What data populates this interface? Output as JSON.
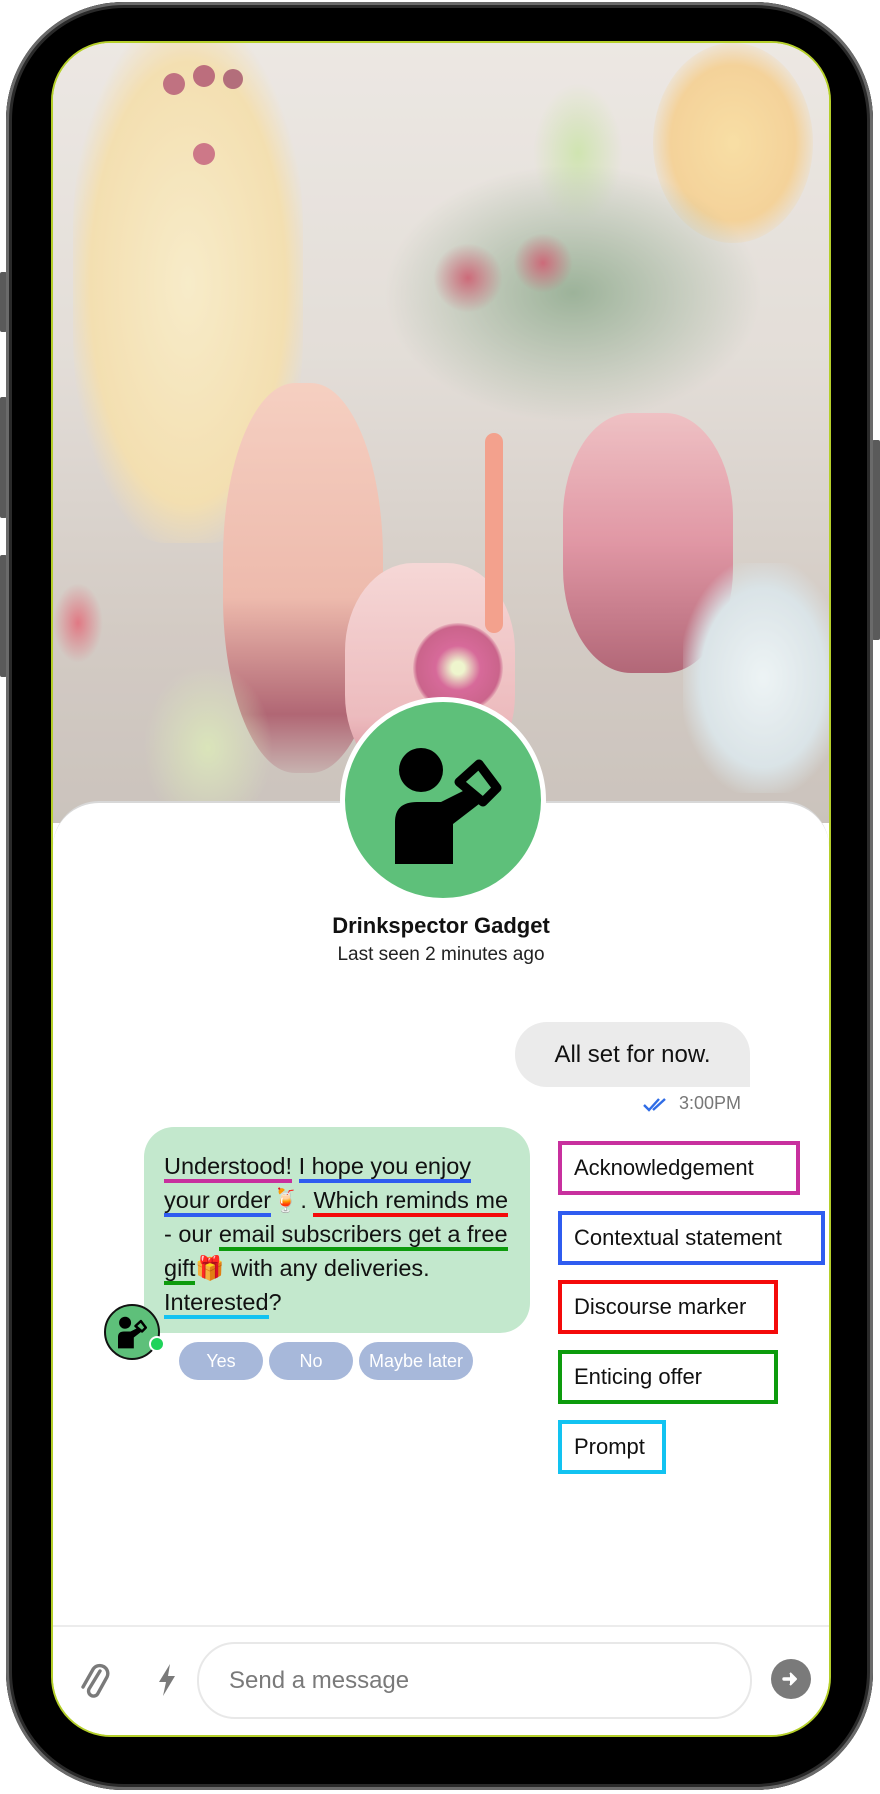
{
  "contact": {
    "name": "Drinkspector Gadget",
    "status": "Last seen 2 minutes ago",
    "avatar_color": "#5ec07a",
    "online_color": "#1fd35a"
  },
  "messages": {
    "outgoing": {
      "text": "All set for now.",
      "time": "3:00PM",
      "read_icon": "double-check-icon",
      "read_color": "#2f6ce6"
    },
    "incoming": {
      "segments": [
        {
          "text": "Understood!",
          "tag": "ack"
        },
        {
          "text": " ",
          "tag": null
        },
        {
          "text": "I hope you enjoy your order",
          "tag": "ctx"
        },
        {
          "text": "🍹. ",
          "tag": null
        },
        {
          "text": "Which reminds me",
          "tag": "dm"
        },
        {
          "text": " - our ",
          "tag": null
        },
        {
          "text": "email subscribers get a free gift",
          "tag": "off"
        },
        {
          "text": "🎁 with any deliveries. ",
          "tag": null
        },
        {
          "text": "Interested",
          "tag": "pr"
        },
        {
          "text": "?",
          "tag": null
        }
      ]
    },
    "quick_replies": [
      "Yes",
      "No",
      "Maybe later"
    ]
  },
  "legend": [
    {
      "key": "ack",
      "label": "Acknowledgement",
      "color": "#c8309e"
    },
    {
      "key": "ctx",
      "label": "Contextual statement",
      "color": "#2f5cf0"
    },
    {
      "key": "dm",
      "label": "Discourse marker",
      "color": "#f40a0a"
    },
    {
      "key": "off",
      "label": "Enticing offer",
      "color": "#0d9b0d"
    },
    {
      "key": "pr",
      "label": "Prompt",
      "color": "#12c3f1"
    }
  ],
  "composer": {
    "placeholder": "Send a message",
    "attach_icon": "paperclip-icon",
    "quick_icon": "lightning-bolt-icon",
    "send_icon": "arrow-right-icon"
  }
}
